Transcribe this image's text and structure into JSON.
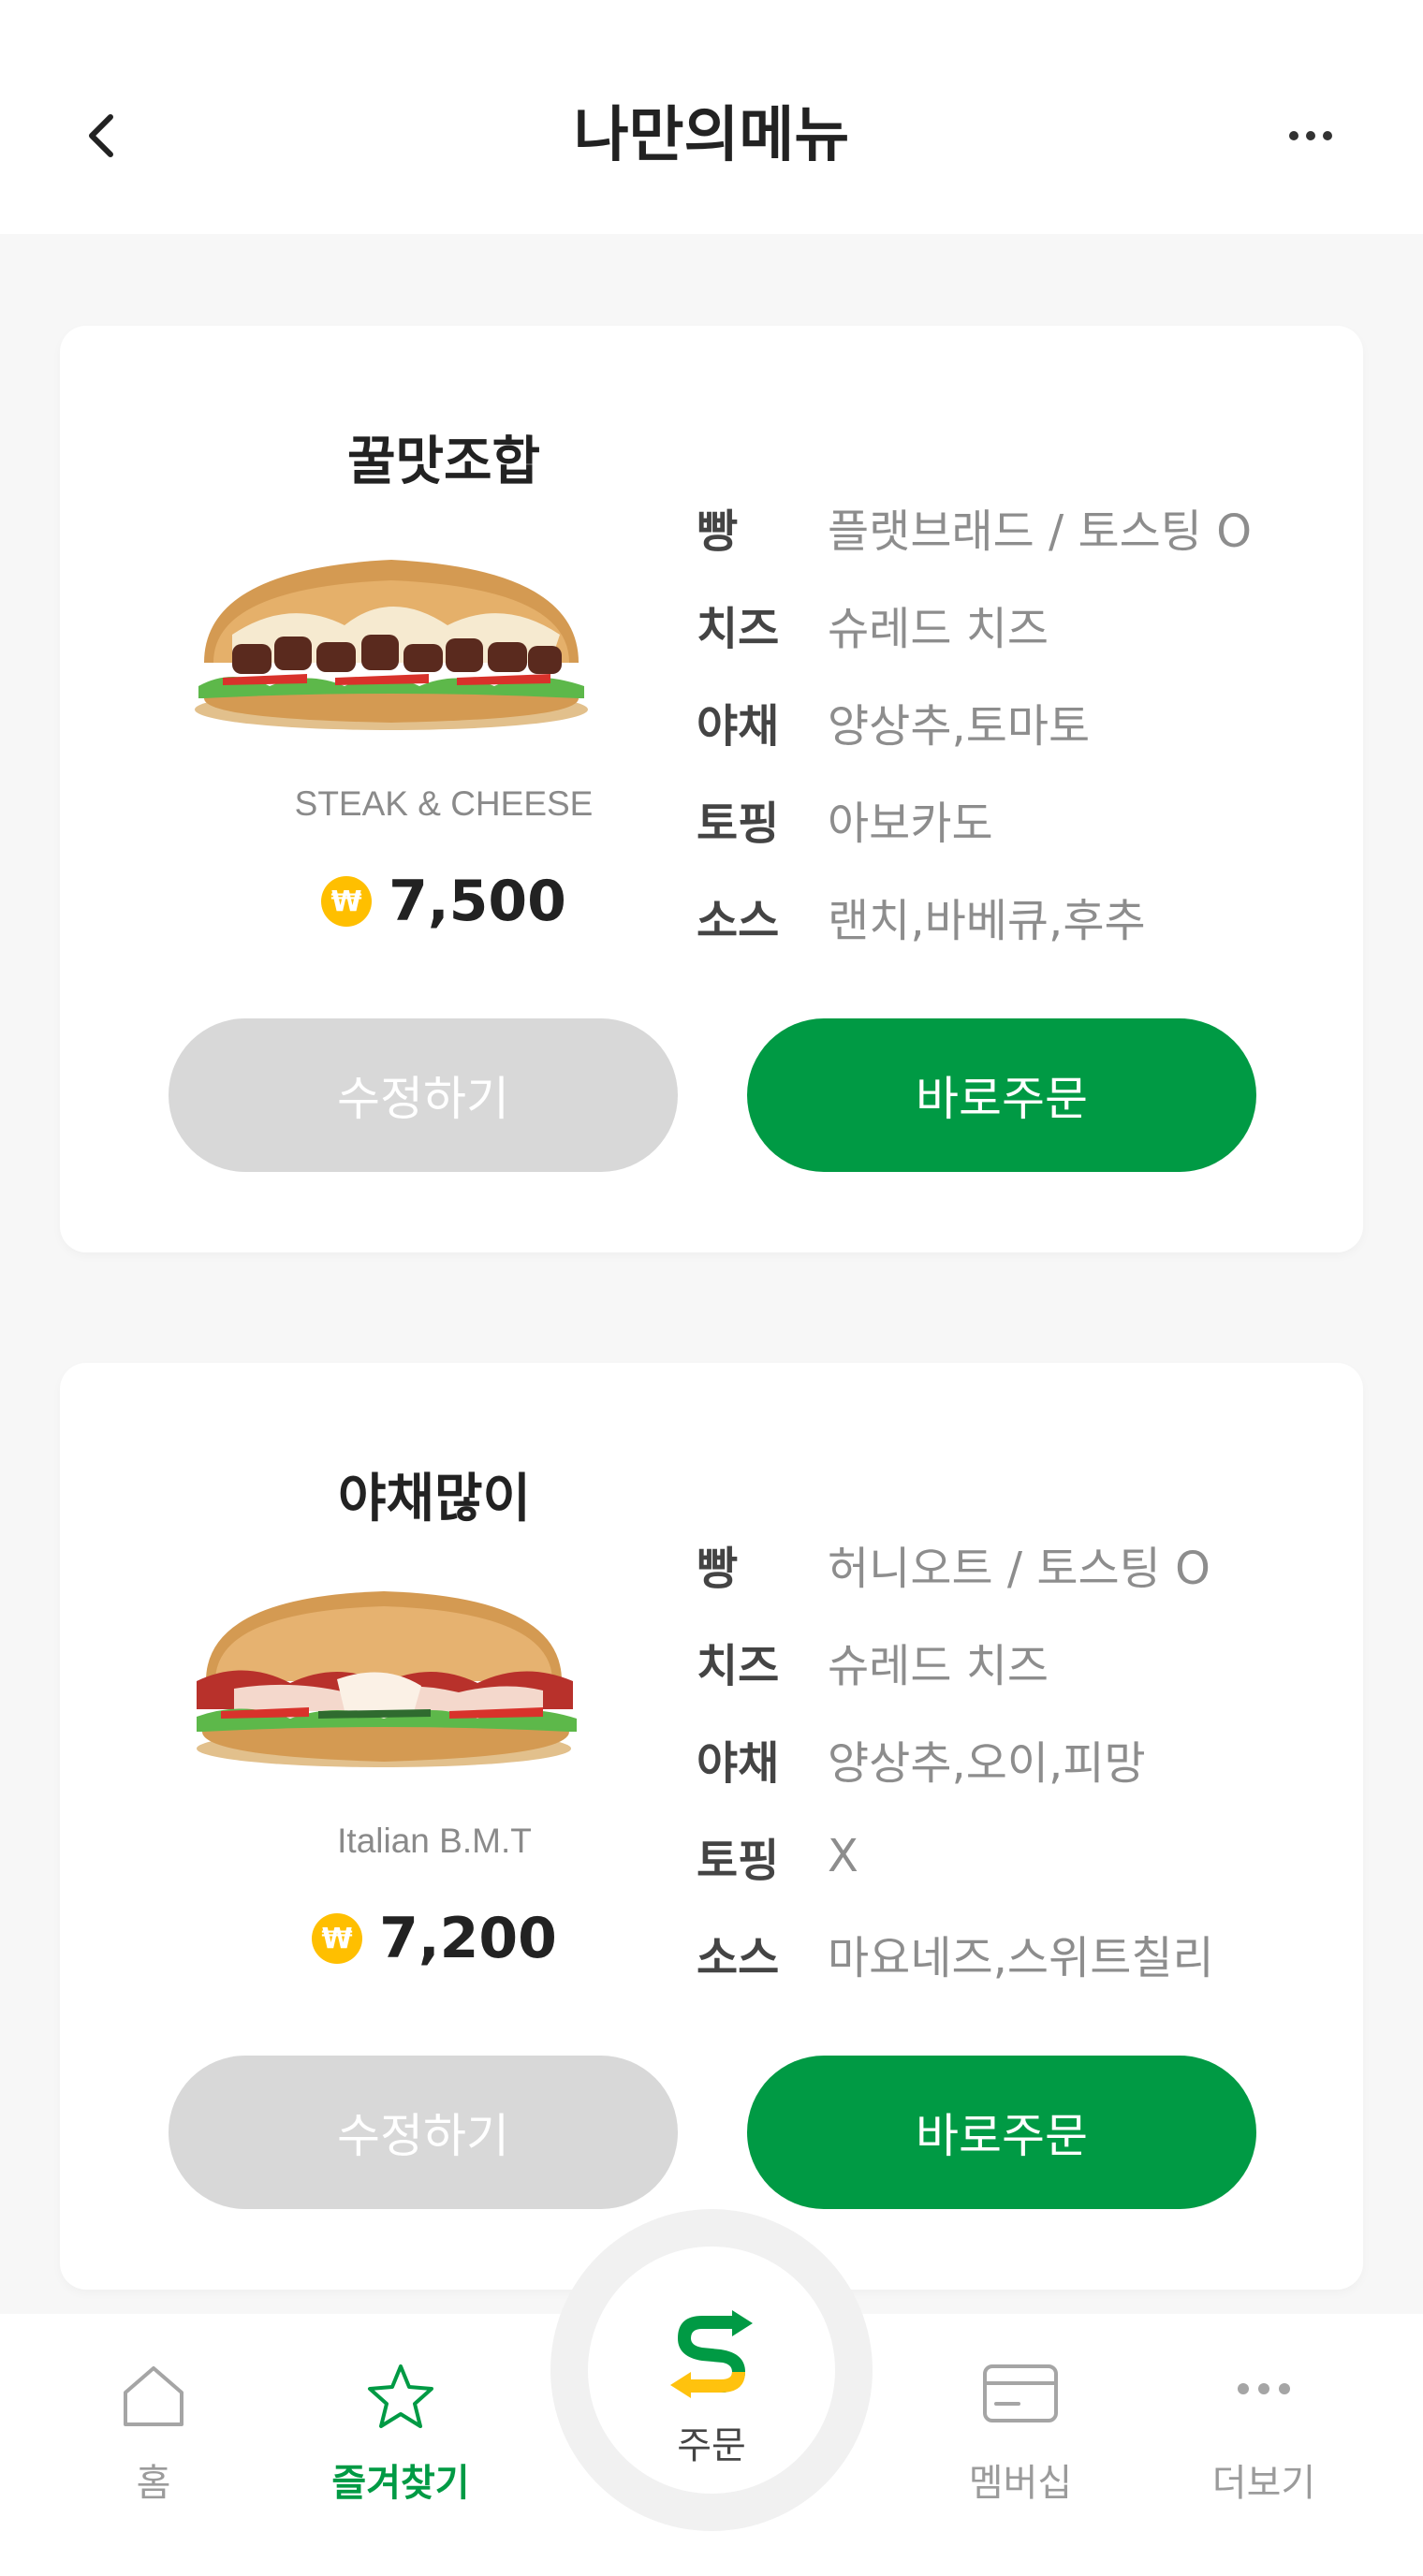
{
  "header": {
    "title": "나만의메뉴",
    "back_icon": "chevron-left-icon",
    "more_icon": "more-horizontal-icon"
  },
  "menus": [
    {
      "name": "꿀맛조합",
      "sandwich": "STEAK & CHEESE",
      "price": "7,500",
      "currency_symbol": "₩",
      "options": [
        {
          "label": "빵",
          "value": "플랫브래드 / 토스팅 O"
        },
        {
          "label": "치즈",
          "value": "슈레드 치즈"
        },
        {
          "label": "야채",
          "value": "양상추,토마토"
        },
        {
          "label": "토핑",
          "value": "아보카도"
        },
        {
          "label": "소스",
          "value": "랜치,바베큐,후추"
        }
      ],
      "edit_label": "수정하기",
      "order_label": "바로주문"
    },
    {
      "name": "야채많이",
      "sandwich": "Italian B.M.T",
      "price": "7,200",
      "currency_symbol": "₩",
      "options": [
        {
          "label": "빵",
          "value": "허니오트 / 토스팅 O"
        },
        {
          "label": "치즈",
          "value": "슈레드 치즈"
        },
        {
          "label": "야채",
          "value": "양상추,오이,피망"
        },
        {
          "label": "토핑",
          "value": "X"
        },
        {
          "label": "소스",
          "value": "마요네즈,스위트칠리"
        }
      ],
      "edit_label": "수정하기",
      "order_label": "바로주문"
    }
  ],
  "bottom_nav": {
    "home": "홈",
    "favorites": "즐겨찾기",
    "order": "주문",
    "membership": "멤버십",
    "more": "더보기",
    "active": "favorites"
  },
  "colors": {
    "brand_green": "#009a44",
    "brand_yellow": "#ffc20e",
    "disabled_gray": "#d8d8d8"
  }
}
